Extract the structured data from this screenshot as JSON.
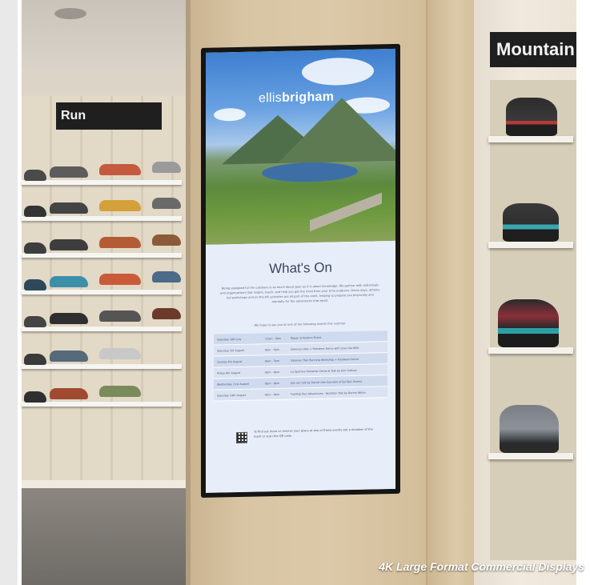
{
  "signs": {
    "run": "Run",
    "mountain": "Mountain"
  },
  "display": {
    "brand_light": "ellis",
    "brand_bold": "brigham",
    "title": "What's On",
    "intro": "Being equipped for the outdoors is as much about gear as it is about knowledge. We partner with individuals and organisations that inspire, teach, and help you get the most from your time outdoors. Demo days, athlete-led workshops and on-the-hill activities are all part of the remit, helping to prepare you physically and mentally for the adventures that await.",
    "subintro": "We hope to see you at one of the following events this summer.",
    "events": [
      {
        "date": "Saturday 20th July",
        "time": "11am - 3pm",
        "name": "Repair & Restore Event"
      },
      {
        "date": "Saturday 3rd August",
        "time": "9am - 5pm",
        "name": "Salomon Hike + Footwear Demo with Love the Wild"
      },
      {
        "date": "Sunday 4th August",
        "time": "9am - 5pm",
        "name": "Salomon Trail Running Workshop + Footwear Demo"
      },
      {
        "date": "Friday 9th August",
        "time": "6pm - 8pm",
        "name": "La Sportiva Footwear Demo & Talk by Kim Collison"
      },
      {
        "date": "Wednesday 21st August",
        "time": "6pm - 8pm",
        "name": "Join our talk by Daniel (the founder) of Go Epic Events"
      },
      {
        "date": "Saturday 24th August",
        "time": "6pm - 8pm",
        "name": "Fuelling Your Adventures - Nutrition Talk by Rachel White"
      }
    ],
    "qr_text": "To find out more or reserve your place at any of these events ask a member of the team or scan the QR code."
  },
  "caption": "4K Large Format Commercial Displays",
  "colors": {
    "screen_panel": "#e8eef9",
    "sign_bg": "#1f1f1f",
    "pillar": "#d8c5a3"
  }
}
